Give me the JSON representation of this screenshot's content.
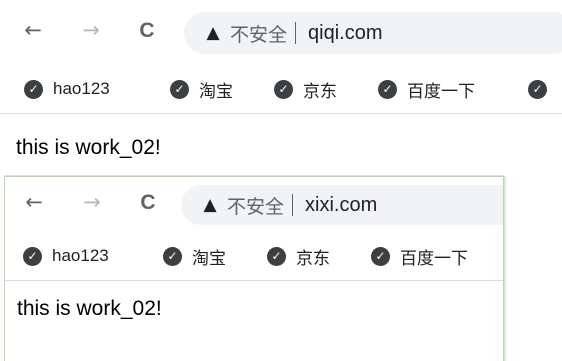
{
  "windows": [
    {
      "toolbar": {
        "back": "←",
        "forward": "→",
        "reload": "C",
        "security_icon": "▲",
        "security_label": "不安全",
        "url": "qiqi.com"
      },
      "bookmarks": [
        {
          "label": "hao123",
          "icon": "globe-icon"
        },
        {
          "label": "淘宝",
          "icon": "globe-icon"
        },
        {
          "label": "京东",
          "icon": "globe-icon"
        },
        {
          "label": "百度一下",
          "icon": "globe-icon"
        },
        {
          "label": "",
          "icon": "globe-icon"
        }
      ],
      "content": {
        "text": "this is work_02!"
      }
    },
    {
      "toolbar": {
        "back": "←",
        "forward": "→",
        "reload": "C",
        "security_icon": "▲",
        "security_label": "不安全",
        "url": "xixi.com"
      },
      "bookmarks": [
        {
          "label": "hao123",
          "icon": "globe-icon"
        },
        {
          "label": "淘宝",
          "icon": "globe-icon"
        },
        {
          "label": "京东",
          "icon": "globe-icon"
        },
        {
          "label": "百度一下",
          "icon": "globe-icon"
        }
      ],
      "content": {
        "text": "this is work_02!"
      }
    }
  ],
  "colors": {
    "omnibox_bg": "#f1f3f4",
    "icon_gray": "#5f6368",
    "window_border": "#bcd8b0"
  }
}
